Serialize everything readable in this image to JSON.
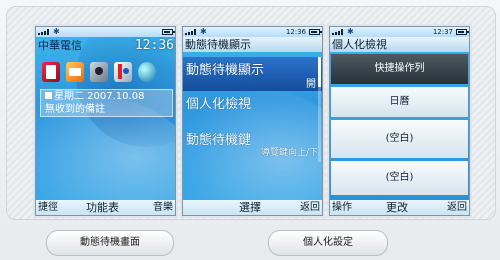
{
  "screen1": {
    "carrier": "中華電信",
    "clock": "12:36",
    "date_text": "星期二 2007.10.08",
    "memo": "無收到的備註",
    "left_soft": "捷徑",
    "center_soft": "功能表",
    "right_soft": "音樂",
    "shortcut_icons": [
      "phonebook-icon",
      "messages-icon",
      "camera-icon",
      "music-icon",
      "browser-icon"
    ]
  },
  "screen2": {
    "title": "動態待機顯示",
    "clock": "12:36",
    "items": [
      {
        "label": "動態待機顯示",
        "value": "開"
      },
      {
        "label": "個人化檢視",
        "value": ""
      },
      {
        "label": "動態待機鍵",
        "value": "導覽鍵向上/下"
      }
    ],
    "center_soft": "選擇",
    "right_soft": "返回"
  },
  "screen3": {
    "title": "個人化檢視",
    "clock": "12:37",
    "options": [
      "快捷操作列",
      "日曆",
      "(空白)",
      "(空白)"
    ],
    "left_soft": "操作",
    "center_soft": "更改",
    "right_soft": "返回"
  },
  "captions": {
    "left": "動態待機畫面",
    "right": "個人化設定"
  },
  "colors": {
    "screen_blue": "#2f97df",
    "highlight": "#1c5fb8",
    "bar_light": "#dff2ff"
  }
}
